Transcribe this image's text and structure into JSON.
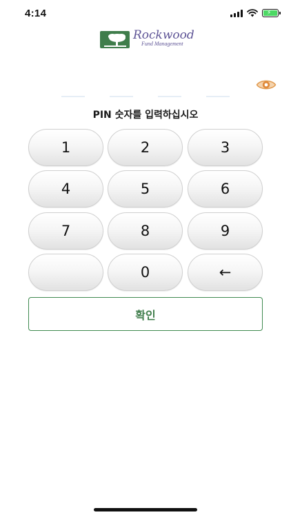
{
  "status_bar": {
    "time": "4:14",
    "icons": [
      "signal-icon",
      "wifi-icon",
      "battery-charging-icon"
    ],
    "battery_color": "#4cd964"
  },
  "logo": {
    "text_main": "Rockwood",
    "text_sub": "Fund Management",
    "mark_color": "#3f7d4b",
    "text_color": "#5e5496"
  },
  "pin": {
    "digits_entered": 0,
    "slots": 4,
    "visibility_icon": "eye-icon",
    "prompt": "PIN 숫자를 입력하십시오"
  },
  "keypad": {
    "keys": [
      "1",
      "2",
      "3",
      "4",
      "5",
      "6",
      "7",
      "8",
      "9",
      "",
      "0",
      "←"
    ]
  },
  "confirm": {
    "label": "확인",
    "accent": "#3f8a4f"
  }
}
